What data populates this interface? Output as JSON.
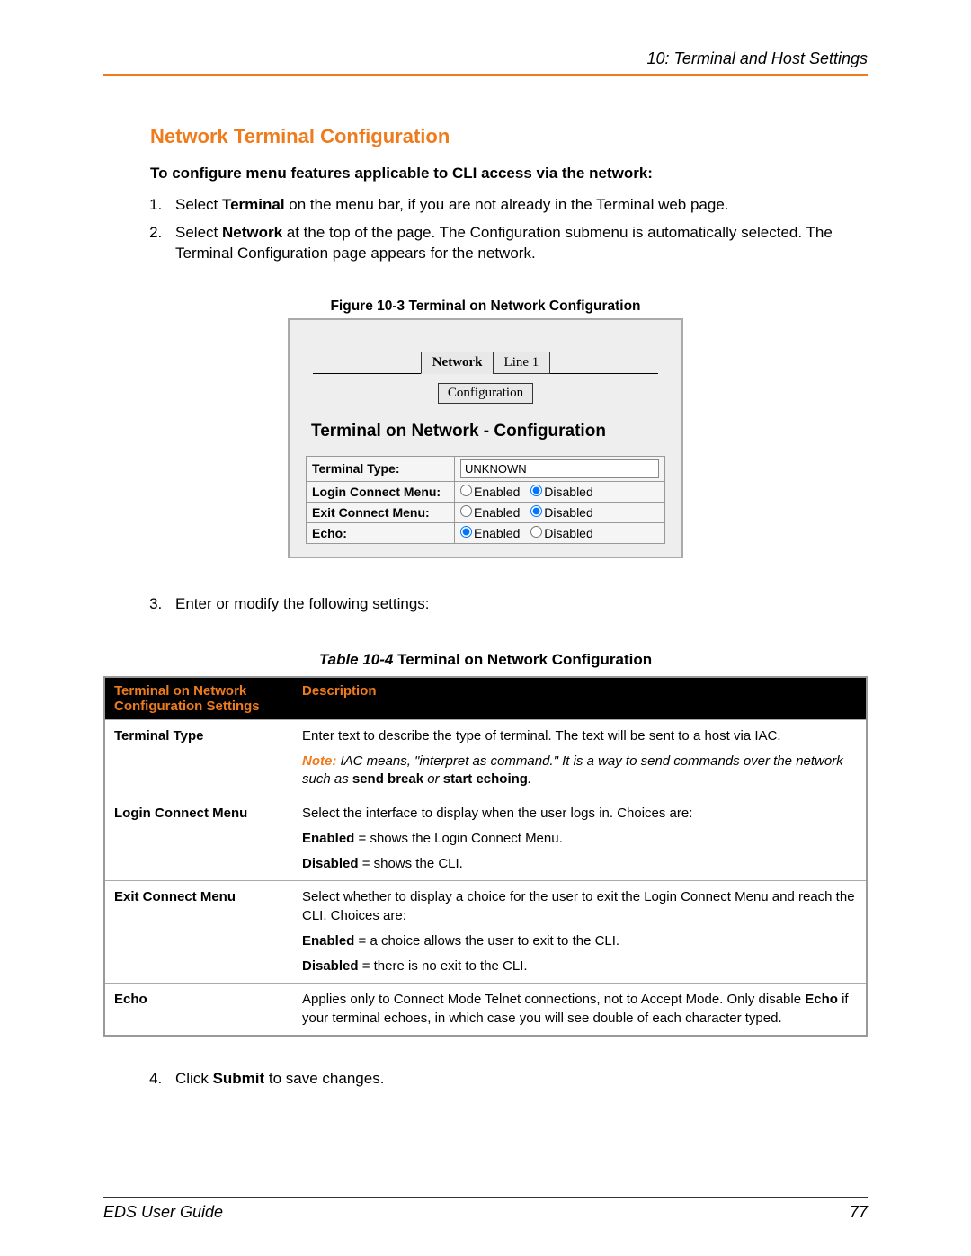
{
  "chapter_header": "10: Terminal and Host Settings",
  "section_title": "Network Terminal Configuration",
  "intro": "To configure menu features applicable to CLI access via the network:",
  "step1_pre": "Select ",
  "step1_bold": "Terminal",
  "step1_post": " on the menu bar, if you are not already in the Terminal web page.",
  "step2_pre": "Select ",
  "step2_bold": "Network",
  "step2_post": " at the top of the page. The Configuration submenu is automatically selected. The Terminal Configuration page appears for the network.",
  "figure_caption": "Figure 10-3  Terminal on Network Configuration",
  "figure": {
    "tab_network": "Network",
    "tab_line1": "Line 1",
    "subtab": "Configuration",
    "heading": "Terminal on Network - Configuration",
    "rows": {
      "terminal_type_label": "Terminal Type:",
      "terminal_type_value": "UNKNOWN",
      "login_menu_label": "Login Connect Menu:",
      "exit_menu_label": "Exit Connect Menu:",
      "echo_label": "Echo:",
      "enabled": "Enabled",
      "disabled": "Disabled"
    }
  },
  "step3": "Enter or modify the following settings:",
  "table_caption_num": "Table 10-4",
  "table_caption_title": "  Terminal on Network Configuration",
  "table": {
    "header_left": "Terminal on Network Configuration Settings",
    "header_right": "Description",
    "rows": [
      {
        "label": "Terminal Type",
        "desc_html": "<p>Enter text to describe the type of terminal. The text will be sent to a host via IAC.</p><p><span class='note-word'>Note:</span> <i>IAC means, \"interpret as command.\" It is a way to send commands over the network such as </i><b>send break</b><i> or </i><b>start echoing</b><i>.</i></p>"
      },
      {
        "label": "Login Connect Menu",
        "desc_html": "<p>Select the interface to display when the user logs in. Choices are:</p><p><b>Enabled</b> = shows the Login Connect Menu.</p><p><b>Disabled</b> = shows the CLI.</p>"
      },
      {
        "label": "Exit Connect Menu",
        "desc_html": "<p>Select whether to display a choice for the user to exit the Login Connect Menu and reach the CLI. Choices are:</p><p><b>Enabled</b> = a choice allows the user to exit to the CLI.</p><p><b>Disabled</b> = there is no exit to the CLI.</p>"
      },
      {
        "label": "Echo",
        "desc_html": "<p>Applies only to Connect Mode Telnet connections, not to Accept Mode. Only disable <b>Echo</b> if your terminal echoes, in which case you will see double of each character typed.</p>"
      }
    ]
  },
  "step4_pre": "Click ",
  "step4_bold": "Submit",
  "step4_post": " to save changes.",
  "footer_left": "EDS User Guide",
  "footer_right": "77"
}
